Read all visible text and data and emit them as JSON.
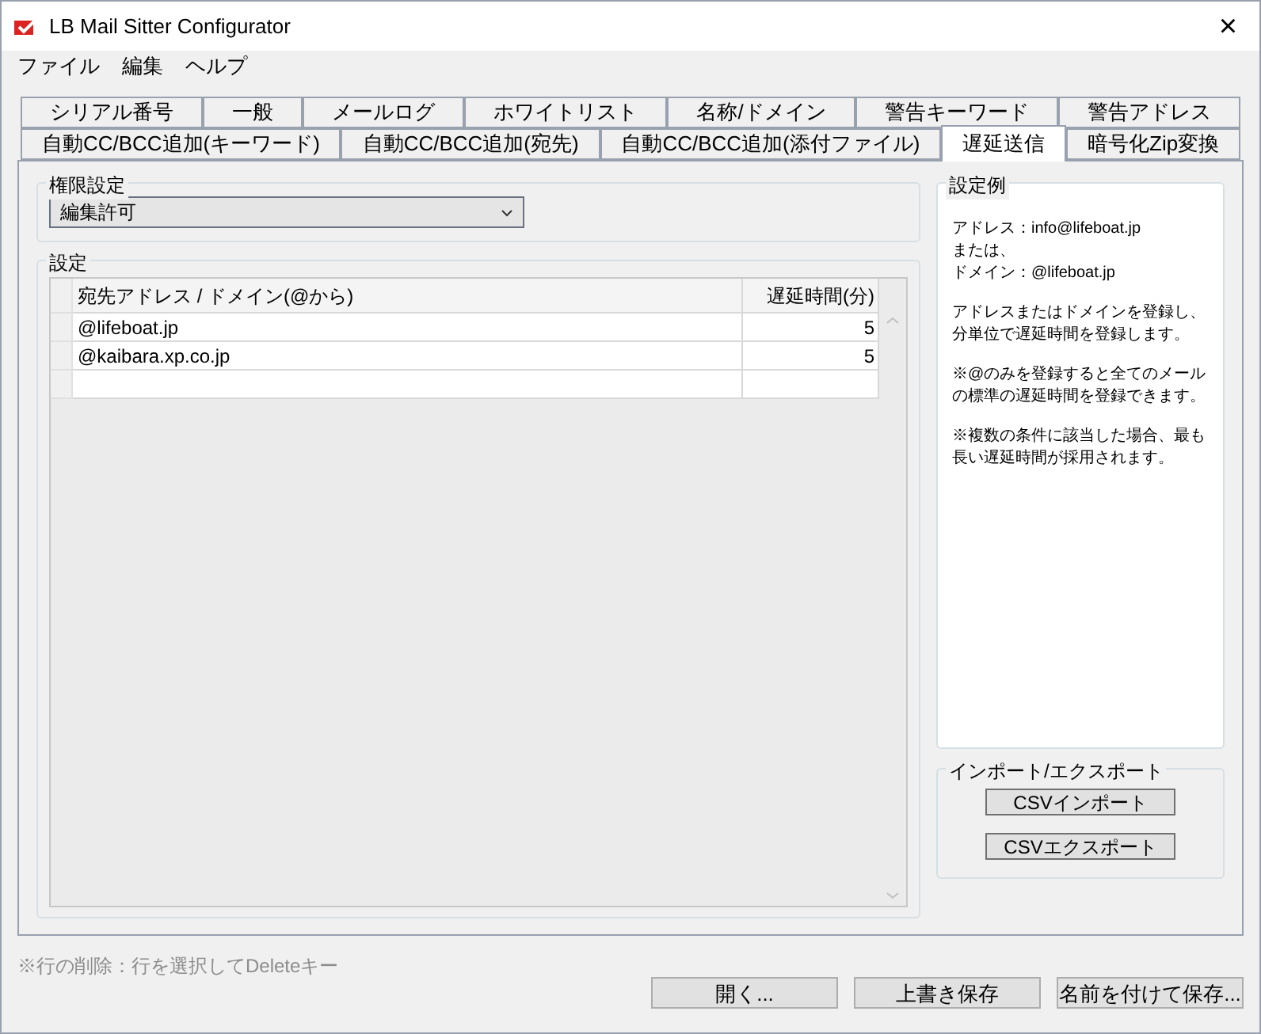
{
  "window": {
    "title": "LB Mail Sitter Configurator",
    "close": "×"
  },
  "menu": [
    "ファイル",
    "編集",
    "ヘルプ"
  ],
  "tab_rows": [
    [
      {
        "label": "シリアル番号",
        "selected": false
      },
      {
        "label": "一般",
        "selected": false
      },
      {
        "label": "メールログ",
        "selected": false
      },
      {
        "label": "ホワイトリスト",
        "selected": false
      },
      {
        "label": "名称/ドメイン",
        "selected": false
      },
      {
        "label": "警告キーワード",
        "selected": false
      },
      {
        "label": "警告アドレス",
        "selected": false
      }
    ],
    [
      {
        "label": "自動CC/BCC追加(キーワード)",
        "selected": false
      },
      {
        "label": "自動CC/BCC追加(宛先)",
        "selected": false
      },
      {
        "label": "自動CC/BCC追加(添付ファイル)",
        "selected": false
      },
      {
        "label": "遅延送信",
        "selected": true
      },
      {
        "label": "暗号化Zip変換",
        "selected": false
      }
    ]
  ],
  "permission": {
    "title": "権限設定",
    "value": "編集許可"
  },
  "settings": {
    "title": "設定",
    "columns": [
      "宛先アドレス / ドメイン(@から)",
      "遅延時間(分)"
    ],
    "rows": [
      [
        "@lifeboat.jp",
        "5"
      ],
      [
        "@kaibara.xp.co.jp",
        "5"
      ]
    ]
  },
  "example": {
    "title": "設定例",
    "paragraphs": [
      [
        "アドレス：info@lifeboat.jp",
        "または、",
        "ドメイン：@lifeboat.jp"
      ],
      [
        "アドレスまたはドメインを登録し、",
        "分単位で遅延時間を登録します。"
      ],
      [
        "※@のみを登録すると全てのメールの標準の遅延時間を登録できます。"
      ],
      [
        "※複数の条件に該当した場合、最も長い遅延時間が採用されます。"
      ]
    ]
  },
  "import_export": {
    "title": "インポート/エクスポート",
    "buttons": [
      "CSVインポート",
      "CSVエクスポート"
    ]
  },
  "hint": "※行の削除：行を選択してDeleteキー",
  "buttons": [
    "開く...",
    "上書き保存",
    "名前を付けて保存..."
  ]
}
